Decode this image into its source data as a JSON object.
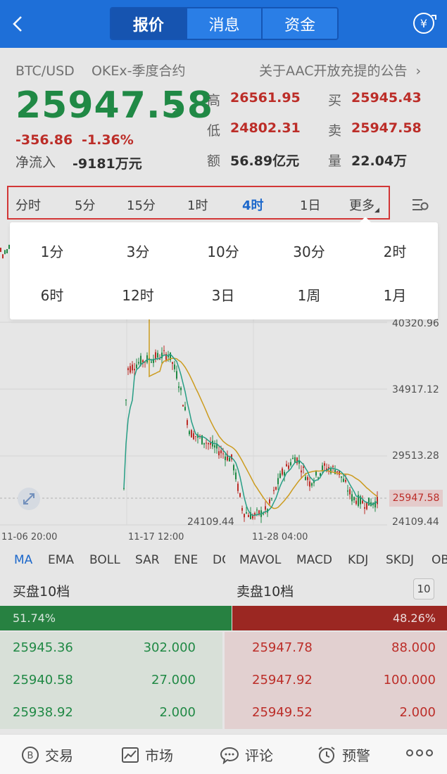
{
  "nav": {
    "tabs": [
      "报价",
      "消息",
      "资金"
    ],
    "active_tab": 0
  },
  "ticker": {
    "pair": "BTC/USD",
    "market": "OKEx-季度合约",
    "notice": "关于AAC开放充提的公告",
    "price": "25947.58",
    "change_abs": "-356.86",
    "change_pct": "-1.36%",
    "inflow_label": "净流入",
    "inflow_value": "-9181万元"
  },
  "stats": {
    "high_label": "高",
    "high": "26561.95",
    "low_label": "低",
    "low": "24802.31",
    "amount_label": "额",
    "amount": "56.89亿元",
    "bid_label": "买",
    "bid": "25945.43",
    "ask_label": "卖",
    "ask": "25947.58",
    "vol_label": "量",
    "vol": "22.04万"
  },
  "periods": {
    "items": [
      "分时",
      "5分",
      "15分",
      "1时",
      "4时",
      "1日",
      "更多"
    ],
    "active": "4时"
  },
  "dropdown": {
    "row1": [
      "1分",
      "3分",
      "10分",
      "30分",
      "2时"
    ],
    "row2": [
      "6时",
      "12时",
      "3日",
      "1周",
      "1月"
    ]
  },
  "chart": {
    "price_labels": [
      "40320.96",
      "34917.12",
      "29513.28",
      "24109.44"
    ],
    "current_price": "25947.58",
    "min_marker": "24109.44",
    "time_labels": [
      "11-06 20:00",
      "11-17 12:00",
      "11-28 04:00"
    ]
  },
  "chart_data": {
    "type": "candlestick",
    "price_axis_ticks": [
      24109.44,
      29513.28,
      34917.12,
      40320.96
    ],
    "current": 25947.58,
    "low_marker": 24109.44
  },
  "indicators": {
    "items": [
      "MA",
      "EMA",
      "BOLL",
      "SAR",
      "ENE",
      "DC",
      "MAVOL",
      "MACD",
      "KDJ",
      "SKDJ",
      "OB"
    ],
    "active": "MA"
  },
  "depth": {
    "buy_title": "买盘10档",
    "sell_title": "卖盘10档",
    "levels": "10",
    "buy_ratio": "51.74%",
    "sell_ratio": "48.26%",
    "buy_ratio_value": 51.74,
    "rows": [
      {
        "bid_price": "25945.36",
        "bid_qty": "302.000",
        "ask_price": "25947.78",
        "ask_qty": "88.000"
      },
      {
        "bid_price": "25940.58",
        "bid_qty": "27.000",
        "ask_price": "25947.92",
        "ask_qty": "100.000"
      },
      {
        "bid_price": "25938.92",
        "bid_qty": "2.000",
        "ask_price": "25949.52",
        "ask_qty": "2.000"
      }
    ]
  },
  "bottom": {
    "trade": "交易",
    "market": "市场",
    "comment": "评论",
    "alert": "预警"
  },
  "colors": {
    "nav_blue": "#1e6fd8",
    "up_green": "#23924a",
    "down_red": "#c8302b",
    "highlight_border": "#e03a3a"
  }
}
